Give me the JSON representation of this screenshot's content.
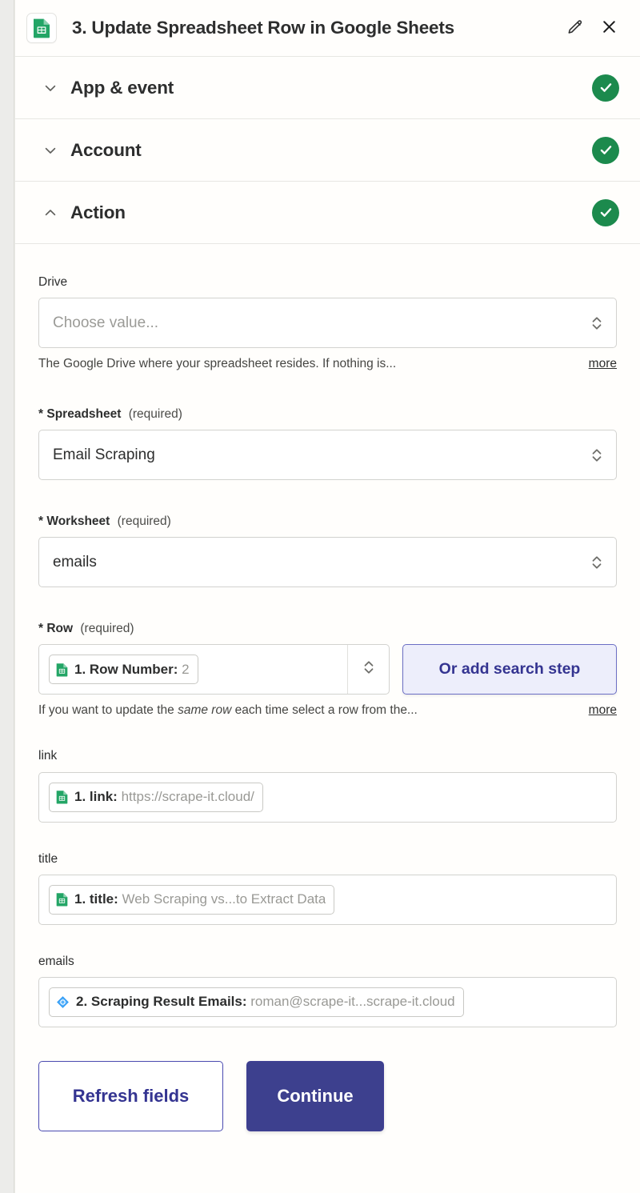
{
  "header": {
    "app_icon": "google-sheets-icon",
    "title": "3. Update Spreadsheet Row in Google Sheets",
    "edit_icon": "pencil-icon",
    "close_icon": "close-icon"
  },
  "sections": [
    {
      "label": "App & event",
      "expanded": false,
      "status": "complete",
      "chevron": "chevron-down-icon"
    },
    {
      "label": "Account",
      "expanded": false,
      "status": "complete",
      "chevron": "chevron-down-icon"
    },
    {
      "label": "Action",
      "expanded": true,
      "status": "complete",
      "chevron": "chevron-up-icon"
    }
  ],
  "action_fields": {
    "drive": {
      "label": "Drive",
      "placeholder": "Choose value...",
      "value": "",
      "help": "The Google Drive where your spreadsheet resides. If nothing is...",
      "more_label": "more"
    },
    "spreadsheet": {
      "star": "*",
      "label": "Spreadsheet",
      "required_note": "(required)",
      "value": "Email Scraping"
    },
    "worksheet": {
      "star": "*",
      "label": "Worksheet",
      "required_note": "(required)",
      "value": "emails"
    },
    "row": {
      "star": "*",
      "label": "Row",
      "required_note": "(required)",
      "token_icon": "google-sheets-icon",
      "token_prefix": "1. Row Number:",
      "token_value": "2",
      "search_step_button": "Or add search step",
      "help_prefix": "If you want to update the ",
      "help_emphasis": "same row",
      "help_suffix": " each time select a row from the...",
      "more_label": "more"
    },
    "link": {
      "label": "link",
      "token_icon": "google-sheets-icon",
      "token_prefix": "1. link:",
      "token_value": "https://scrape-it.cloud/"
    },
    "title": {
      "label": "title",
      "token_icon": "google-sheets-icon",
      "token_prefix": "1. title:",
      "token_value": "Web Scraping vs...to Extract Data"
    },
    "emails": {
      "label": "emails",
      "token_icon": "blue-diamond-icon",
      "token_prefix": "2. Scraping Result Emails:",
      "token_value": "roman@scrape-it...scrape-it.cloud"
    }
  },
  "footer": {
    "refresh_label": "Refresh fields",
    "continue_label": "Continue"
  },
  "colors": {
    "status_green": "#1c8a4d",
    "primary_indigo": "#3d408e",
    "secondary_indigo_text": "#343491",
    "search_btn_bg": "#edeefb",
    "panel_bg": "#fffefc",
    "placeholder_gray": "#9b9b97"
  }
}
